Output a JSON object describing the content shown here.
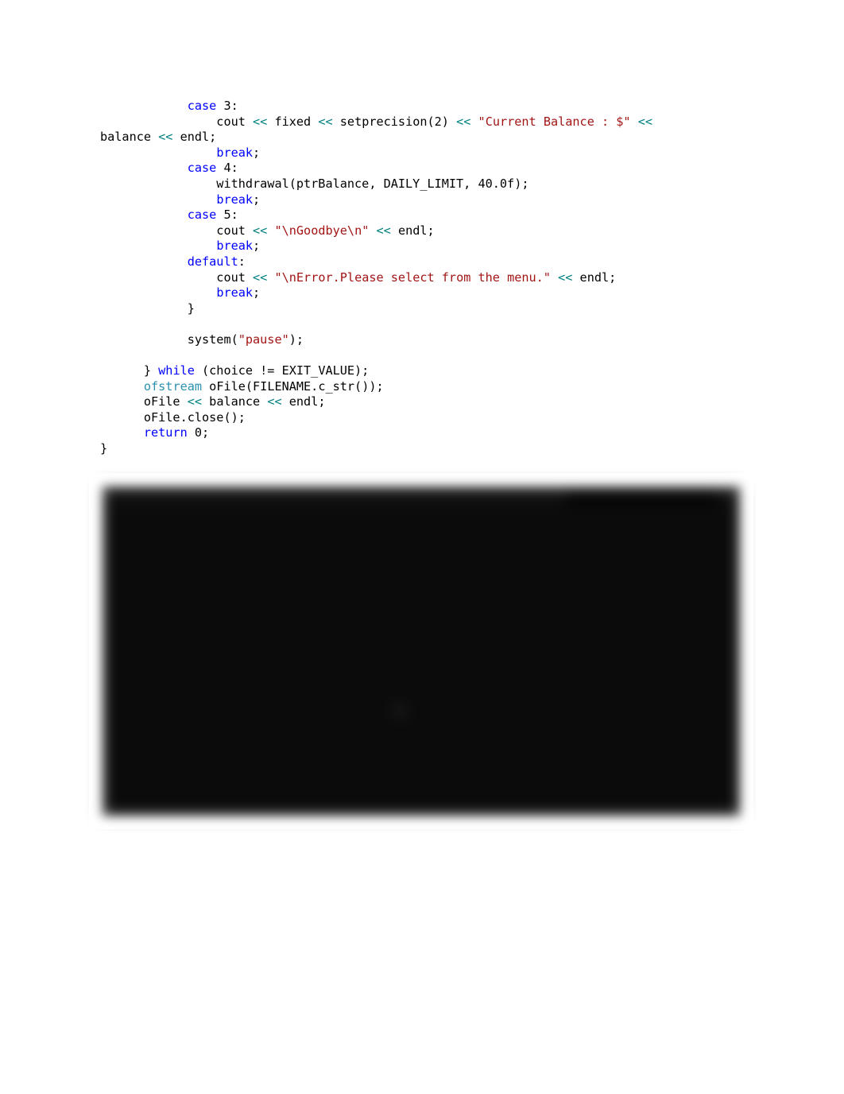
{
  "document": {
    "type": "source-code-listing-with-console-screenshot",
    "background_color": "#ffffff"
  },
  "code": {
    "language": "C++",
    "syntax_colors": {
      "keyword": "#0000ff",
      "string": "#a31515",
      "stream_operator": "#008080",
      "type": "#2b91af",
      "plain": "#000000"
    },
    "lines": [
      {
        "id": "line-case-3",
        "text": "            case 3:",
        "tokens": [
          {
            "t": "            ",
            "c": "plain"
          },
          {
            "t": "case",
            "c": "kw"
          },
          {
            "t": " 3:",
            "c": "plain"
          }
        ]
      },
      {
        "id": "line-cout-balance",
        "text": "                cout << fixed << setprecision(2) << \"Current Balance : $\" <<",
        "tokens": [
          {
            "t": "                cout ",
            "c": "plain"
          },
          {
            "t": "<<",
            "c": "op"
          },
          {
            "t": " fixed ",
            "c": "plain"
          },
          {
            "t": "<<",
            "c": "op"
          },
          {
            "t": " setprecision(2) ",
            "c": "plain"
          },
          {
            "t": "<<",
            "c": "op"
          },
          {
            "t": " ",
            "c": "plain"
          },
          {
            "t": "\"Current Balance : $\"",
            "c": "str"
          },
          {
            "t": " ",
            "c": "plain"
          },
          {
            "t": "<<",
            "c": "op"
          }
        ]
      },
      {
        "id": "line-balance-endl-wrap",
        "text": "balance << endl;",
        "wrapped": true,
        "tokens": [
          {
            "t": "balance ",
            "c": "plain"
          },
          {
            "t": "<<",
            "c": "op"
          },
          {
            "t": " endl;",
            "c": "plain"
          }
        ]
      },
      {
        "id": "line-break-1",
        "text": "                break;",
        "tokens": [
          {
            "t": "                ",
            "c": "plain"
          },
          {
            "t": "break",
            "c": "kw"
          },
          {
            "t": ";",
            "c": "plain"
          }
        ]
      },
      {
        "id": "line-case-4",
        "text": "            case 4:",
        "tokens": [
          {
            "t": "            ",
            "c": "plain"
          },
          {
            "t": "case",
            "c": "kw"
          },
          {
            "t": " 4:",
            "c": "plain"
          }
        ]
      },
      {
        "id": "line-withdrawal",
        "text": "                withdrawal(ptrBalance, DAILY_LIMIT, 40.0f);",
        "tokens": [
          {
            "t": "                withdrawal(ptrBalance, DAILY_LIMIT, 40.0f);",
            "c": "plain"
          }
        ]
      },
      {
        "id": "line-break-2",
        "text": "                break;",
        "tokens": [
          {
            "t": "                ",
            "c": "plain"
          },
          {
            "t": "break",
            "c": "kw"
          },
          {
            "t": ";",
            "c": "plain"
          }
        ]
      },
      {
        "id": "line-case-5",
        "text": "            case 5:",
        "tokens": [
          {
            "t": "            ",
            "c": "plain"
          },
          {
            "t": "case",
            "c": "kw"
          },
          {
            "t": " 5:",
            "c": "plain"
          }
        ]
      },
      {
        "id": "line-cout-goodbye",
        "text": "                cout << \"\\nGoodbye\\n\" << endl;",
        "tokens": [
          {
            "t": "                cout ",
            "c": "plain"
          },
          {
            "t": "<<",
            "c": "op"
          },
          {
            "t": " ",
            "c": "plain"
          },
          {
            "t": "\"\\nGoodbye\\n\"",
            "c": "str"
          },
          {
            "t": " ",
            "c": "plain"
          },
          {
            "t": "<<",
            "c": "op"
          },
          {
            "t": " endl;",
            "c": "plain"
          }
        ]
      },
      {
        "id": "line-break-3",
        "text": "                break;",
        "tokens": [
          {
            "t": "                ",
            "c": "plain"
          },
          {
            "t": "break",
            "c": "kw"
          },
          {
            "t": ";",
            "c": "plain"
          }
        ]
      },
      {
        "id": "line-default",
        "text": "            default:",
        "tokens": [
          {
            "t": "            ",
            "c": "plain"
          },
          {
            "t": "default",
            "c": "kw"
          },
          {
            "t": ":",
            "c": "plain"
          }
        ]
      },
      {
        "id": "line-cout-error",
        "text": "                cout << \"\\nError.Please select from the menu.\" << endl;",
        "tokens": [
          {
            "t": "                cout ",
            "c": "plain"
          },
          {
            "t": "<<",
            "c": "op"
          },
          {
            "t": " ",
            "c": "plain"
          },
          {
            "t": "\"\\nError.Please select from the menu.\"",
            "c": "str"
          },
          {
            "t": " ",
            "c": "plain"
          },
          {
            "t": "<<",
            "c": "op"
          },
          {
            "t": " endl;",
            "c": "plain"
          }
        ]
      },
      {
        "id": "line-break-4",
        "text": "                break;",
        "tokens": [
          {
            "t": "                ",
            "c": "plain"
          },
          {
            "t": "break",
            "c": "kw"
          },
          {
            "t": ";",
            "c": "plain"
          }
        ]
      },
      {
        "id": "line-close-switch",
        "text": "            }",
        "tokens": [
          {
            "t": "            }",
            "c": "plain"
          }
        ]
      },
      {
        "id": "line-blank-1",
        "text": "",
        "blank": true,
        "tokens": []
      },
      {
        "id": "line-system-pause",
        "text": "            system(\"pause\");",
        "tokens": [
          {
            "t": "            system(",
            "c": "plain"
          },
          {
            "t": "\"pause\"",
            "c": "str"
          },
          {
            "t": ");",
            "c": "plain"
          }
        ]
      },
      {
        "id": "line-blank-2",
        "text": "",
        "blank": true,
        "tokens": []
      },
      {
        "id": "line-while",
        "text": "      } while (choice != EXIT_VALUE);",
        "tokens": [
          {
            "t": "      } ",
            "c": "plain"
          },
          {
            "t": "while",
            "c": "kw"
          },
          {
            "t": " (choice != EXIT_VALUE);",
            "c": "plain"
          }
        ]
      },
      {
        "id": "line-ofstream",
        "text": "      ofstream oFile(FILENAME.c_str());",
        "tokens": [
          {
            "t": "      ",
            "c": "plain"
          },
          {
            "t": "ofstream",
            "c": "type"
          },
          {
            "t": " oFile(FILENAME.c_str());",
            "c": "plain"
          }
        ]
      },
      {
        "id": "line-ofile-balance",
        "text": "      oFile << balance << endl;",
        "tokens": [
          {
            "t": "      oFile ",
            "c": "plain"
          },
          {
            "t": "<<",
            "c": "op"
          },
          {
            "t": " balance ",
            "c": "plain"
          },
          {
            "t": "<<",
            "c": "op"
          },
          {
            "t": " endl;",
            "c": "plain"
          }
        ]
      },
      {
        "id": "line-ofile-close",
        "text": "      oFile.close();",
        "tokens": [
          {
            "t": "      oFile.close();",
            "c": "plain"
          }
        ]
      },
      {
        "id": "line-return",
        "text": "      return 0;",
        "tokens": [
          {
            "t": "      ",
            "c": "plain"
          },
          {
            "t": "return",
            "c": "kw"
          },
          {
            "t": " 0;",
            "c": "plain"
          }
        ]
      },
      {
        "id": "line-close-main",
        "text": "}",
        "tokens": [
          {
            "t": "}",
            "c": "plain"
          }
        ]
      }
    ]
  },
  "console_screenshot": {
    "description": "blurred black console window screenshot",
    "background_color": "#0b0b0b",
    "titlebar_color": "#111111",
    "blur_radius_px": 9,
    "legible": false,
    "title_text": "",
    "window_controls": "",
    "output_lines": [
      "",
      "",
      "",
      "",
      "",
      "",
      "",
      "",
      "",
      "",
      ""
    ]
  }
}
